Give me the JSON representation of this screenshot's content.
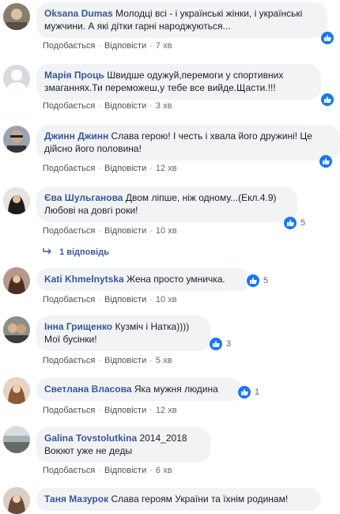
{
  "ui": {
    "like_label": "Подобається",
    "reply_label": "Відповісти",
    "accent": "#385898",
    "like_color": "#1877f2"
  },
  "comments": [
    {
      "author": "Oksana Dumas",
      "text": "Молодці всі - і українські жінки, і українські мужчини. А які дітки гарні народжуються...",
      "time": "7 хв",
      "reactions": ""
    },
    {
      "author": "Марія Проць",
      "text": "Швидше одужуй,перемоги у спортивних змаганнях.Ти переможеш,у тебе все вийде.Щасти.!!!",
      "time": "3 хв",
      "reactions": ""
    },
    {
      "author": "Джинн Джинн",
      "text": "Слава герою! І честь і хвала його дружині! Це дійсно його половина!",
      "time": "12 хв",
      "reactions": ""
    },
    {
      "author": "Єва Шульганова",
      "text": "Двом ліпше, ніж одному...(Екл.4.9) Любові на довгі роки!",
      "time": "10 хв",
      "reactions": "5",
      "replies": "1 відповідь"
    },
    {
      "author": "Kati Khmelnytska",
      "text": "Жена просто умничка.",
      "time": "10 хв",
      "reactions": "5"
    },
    {
      "author": "Інна Грищенко",
      "text": "Кузміч і Натка)))) Мої бусінки!",
      "time": "5 хв",
      "reactions": "3"
    },
    {
      "author": "Светлана Власова",
      "text": "Яка мужня людина",
      "time": "12 хв",
      "reactions": "1"
    },
    {
      "author": "Galina Tovstolutkina",
      "text": "2014_2018 Воюют уже не деды",
      "time": "6 хв",
      "reactions": ""
    },
    {
      "author": "Таня Мазурок",
      "text": "Слава героям України та їхнім родинам!",
      "time": "",
      "reactions": ""
    }
  ]
}
